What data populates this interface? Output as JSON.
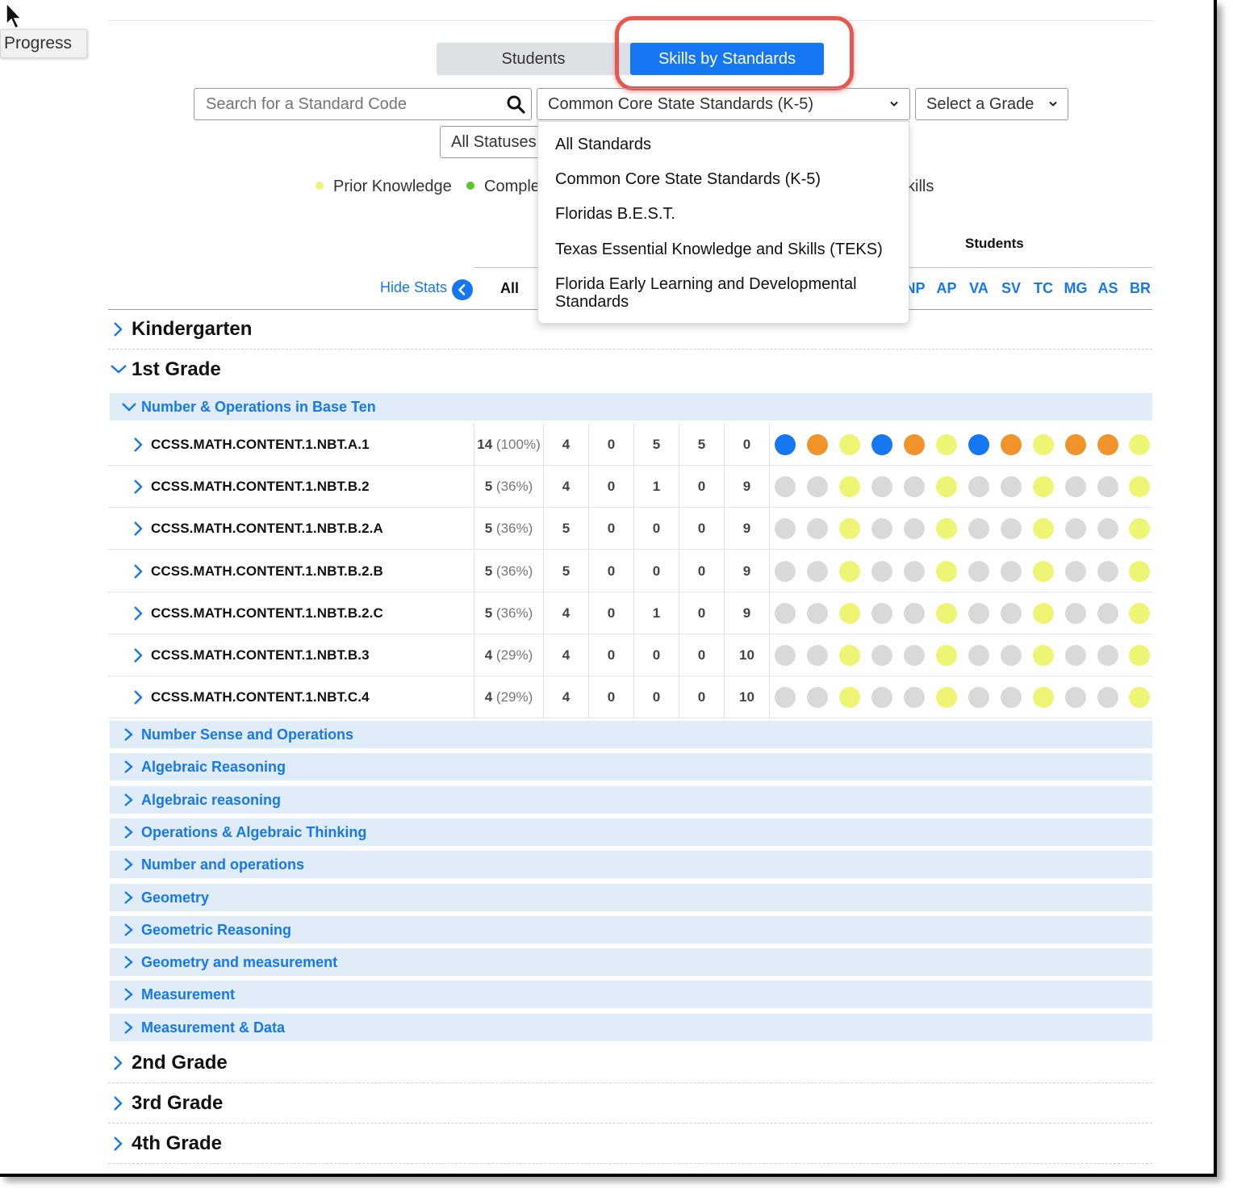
{
  "tooltip": "Progress",
  "tabs": {
    "students": "Students",
    "skills": "Skills by Standards"
  },
  "search": {
    "placeholder": "Search for a Standard Code"
  },
  "standard_select": {
    "value": "Common Core State Standards (K-5)"
  },
  "grade_select": {
    "value": "Select a Grade"
  },
  "status_select": {
    "value": "All Statuses"
  },
  "legend": {
    "prior": "Prior Knowledge",
    "complete": "Comple",
    "skills_tail": "kills"
  },
  "colors": {
    "accent": "#1677f2",
    "orange": "#f0932b",
    "yellow": "#eef575",
    "gray": "#d9d9d9",
    "highlight": "#e8574f"
  },
  "dropdown_options": [
    "All Standards",
    "Common Core State Standards (K-5)",
    "Floridas B.E.S.T.",
    "Texas Essential Knowledge and Skills (TEKS)",
    "Florida Early Learning and Developmental Standards"
  ],
  "table_header": {
    "students_label": "Students",
    "hide_stats": "Hide Stats",
    "all": "All",
    "initials": [
      "NP",
      "AP",
      "VA",
      "SV",
      "TC",
      "MG",
      "AS",
      "BR"
    ]
  },
  "grades": [
    "Kindergarten",
    "1st Grade",
    "2nd Grade",
    "3rd Grade",
    "4th Grade"
  ],
  "open_domain": "Number & Operations in Base Ten",
  "standards": [
    {
      "code": "CCSS.MATH.CONTENT.1.NBT.A.1",
      "count": "14",
      "pct": "(100%)",
      "stats": [
        "4",
        "0",
        "5",
        "5",
        "0"
      ],
      "dots": [
        "b",
        "o",
        "y",
        "b",
        "o",
        "y",
        "b",
        "o",
        "y",
        "o",
        "o",
        "y"
      ]
    },
    {
      "code": "CCSS.MATH.CONTENT.1.NBT.B.2",
      "count": "5",
      "pct": "(36%)",
      "stats": [
        "4",
        "0",
        "1",
        "0",
        "9"
      ],
      "dots": [
        "g",
        "g",
        "y",
        "g",
        "g",
        "y",
        "g",
        "g",
        "y",
        "g",
        "g",
        "y"
      ]
    },
    {
      "code": "CCSS.MATH.CONTENT.1.NBT.B.2.A",
      "count": "5",
      "pct": "(36%)",
      "stats": [
        "5",
        "0",
        "0",
        "0",
        "9"
      ],
      "dots": [
        "g",
        "g",
        "y",
        "g",
        "g",
        "y",
        "g",
        "g",
        "y",
        "g",
        "g",
        "y"
      ]
    },
    {
      "code": "CCSS.MATH.CONTENT.1.NBT.B.2.B",
      "count": "5",
      "pct": "(36%)",
      "stats": [
        "5",
        "0",
        "0",
        "0",
        "9"
      ],
      "dots": [
        "g",
        "g",
        "y",
        "g",
        "g",
        "y",
        "g",
        "g",
        "y",
        "g",
        "g",
        "y"
      ]
    },
    {
      "code": "CCSS.MATH.CONTENT.1.NBT.B.2.C",
      "count": "5",
      "pct": "(36%)",
      "stats": [
        "4",
        "0",
        "1",
        "0",
        "9"
      ],
      "dots": [
        "g",
        "g",
        "y",
        "g",
        "g",
        "y",
        "g",
        "g",
        "y",
        "g",
        "g",
        "y"
      ]
    },
    {
      "code": "CCSS.MATH.CONTENT.1.NBT.B.3",
      "count": "4",
      "pct": "(29%)",
      "stats": [
        "4",
        "0",
        "0",
        "0",
        "10"
      ],
      "dots": [
        "g",
        "g",
        "y",
        "g",
        "g",
        "y",
        "g",
        "g",
        "y",
        "g",
        "g",
        "y"
      ]
    },
    {
      "code": "CCSS.MATH.CONTENT.1.NBT.C.4",
      "count": "4",
      "pct": "(29%)",
      "stats": [
        "4",
        "0",
        "0",
        "0",
        "10"
      ],
      "dots": [
        "g",
        "g",
        "y",
        "g",
        "g",
        "y",
        "g",
        "g",
        "y",
        "g",
        "g",
        "y"
      ]
    }
  ],
  "collapsed_domains": [
    "Number Sense and Operations",
    "Algebraic Reasoning",
    "Algebraic reasoning",
    "Operations & Algebraic Thinking",
    "Number and operations",
    "Geometry",
    "Geometric Reasoning",
    "Geometry and measurement",
    "Measurement",
    "Measurement & Data"
  ]
}
